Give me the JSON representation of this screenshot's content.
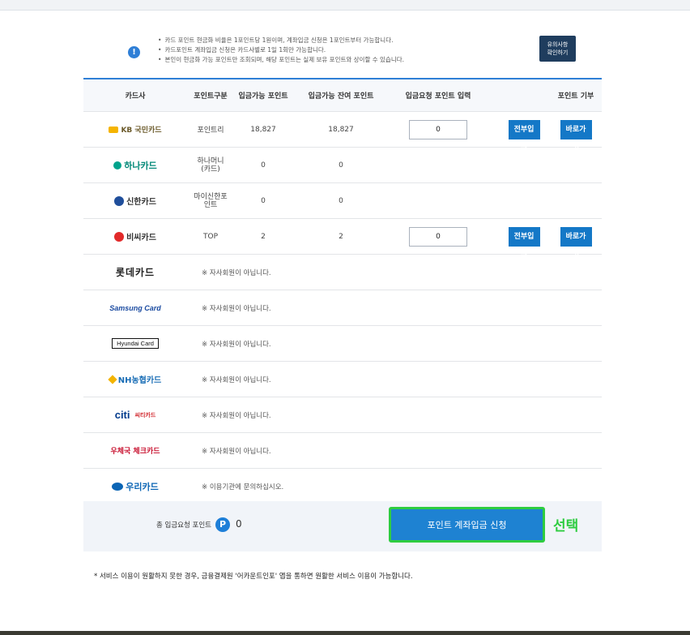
{
  "notice": {
    "lines": [
      "카드 포인트 현금화 비율은 1포인트당 1원이며, 계좌입금 신청은 1포인트부터 가능합니다.",
      "카드포인트 계좌입금 신청은 카드사별로 1일 1회만 가능합니다.",
      "본인이 현금화 가능 포인트만 조회되며, 해당 포인트는 실제 보유 포인트와 상이할 수 있습니다."
    ],
    "caution_button": "유의사항\n확인하기"
  },
  "table": {
    "headers": {
      "card": "카드사",
      "type": "포인트구분",
      "available": "입금가능 포인트",
      "remaining": "입금가능 잔여 포인트",
      "input": "입금요청 포인트 입력",
      "donate": "포인트 기부"
    },
    "rows": [
      {
        "logo": "KB국민카드",
        "logo_text": "KB 국민카드",
        "type": "포인트리",
        "available": "18,827",
        "remaining": "18,827",
        "input_value": "0",
        "btn_all": "전부입금",
        "btn_go": "바로가기"
      },
      {
        "logo": "하나카드",
        "logo_text": "하나카드",
        "type": "하나머니\n(카드)",
        "available": "0",
        "remaining": "0"
      },
      {
        "logo": "신한카드",
        "logo_text": "신한카드",
        "type": "마이신한포\n인트",
        "available": "0",
        "remaining": "0"
      },
      {
        "logo": "비씨카드",
        "logo_text": "비씨카드",
        "type": "TOP",
        "available": "2",
        "remaining": "2",
        "input_value": "0",
        "btn_all": "전부입금",
        "btn_go": "바로가기"
      },
      {
        "logo": "롯데카드",
        "logo_text": "롯데카드",
        "message": "※ 자사회원이 아닙니다."
      },
      {
        "logo": "삼성카드",
        "logo_text": "Samsung Card",
        "message": "※ 자사회원이 아닙니다."
      },
      {
        "logo": "현대카드",
        "logo_text": "Hyundai Card",
        "message": "※ 자사회원이 아닙니다."
      },
      {
        "logo": "NH농협카드",
        "logo_text": "NH농협카드",
        "message": "※ 자사회원이 아닙니다."
      },
      {
        "logo": "씨티카드",
        "logo_text": "citi",
        "logo_sub": "씨티카드",
        "message": "※ 자사회원이 아닙니다."
      },
      {
        "logo": "우체국체크카드",
        "logo_text": "우체국 체크카드",
        "message": "※ 자사회원이 아닙니다."
      },
      {
        "logo": "우리카드",
        "logo_text": "우리카드",
        "message": "※ 이용기관에 문의하십시오."
      }
    ]
  },
  "summary": {
    "label": "총 입금요청 포인트",
    "badge": "P",
    "value": "0",
    "apply_button": "포인트 계좌입금 신청",
    "annotation": "선택"
  },
  "footer": {
    "note": "* 서비스 이용이 원활하지 못한 경우, 금융결제원 '어카운트인포' 앱을 통하면 원활한 서비스 이용이 가능합니다."
  },
  "colors": {
    "accent": "#1e82d2",
    "highlight": "#2ecc40",
    "caution_button": "#1f3d5e"
  }
}
